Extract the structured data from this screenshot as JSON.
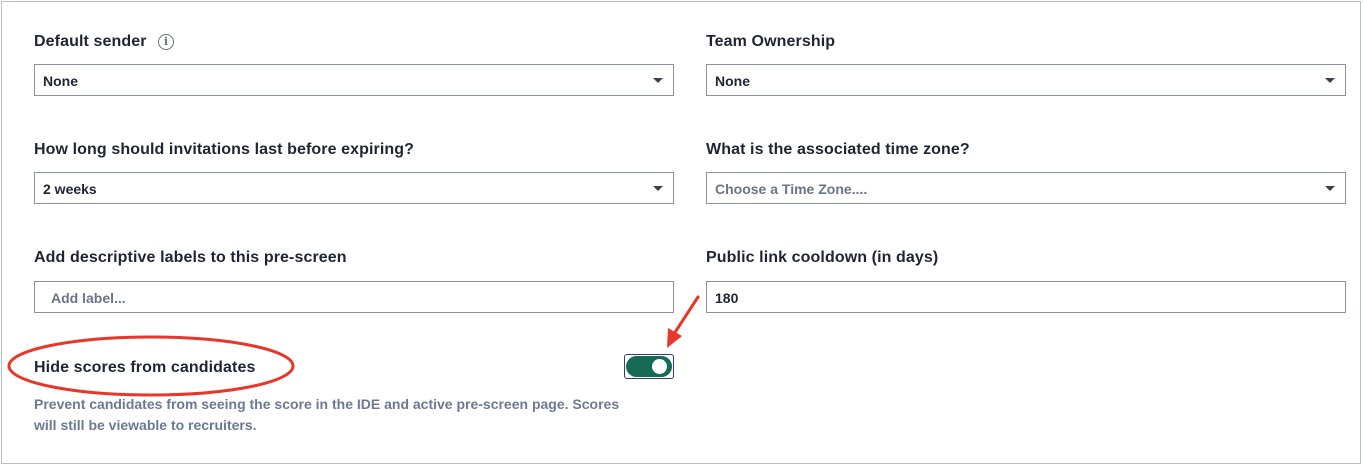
{
  "form": {
    "default_sender": {
      "label": "Default sender",
      "value": "None"
    },
    "team_ownership": {
      "label": "Team Ownership",
      "value": "None"
    },
    "invitation_expiry": {
      "label": "How long should invitations last before expiring?",
      "value": "2 weeks"
    },
    "time_zone": {
      "label": "What is the associated time zone?",
      "placeholder": "Choose a Time Zone...."
    },
    "labels": {
      "label": "Add descriptive labels to this pre-screen",
      "placeholder": "Add label..."
    },
    "public_link_cooldown": {
      "label": "Public link cooldown (in days)",
      "value": "180"
    },
    "hide_scores": {
      "label": "Hide scores from candidates",
      "enabled": true,
      "helper_line1": "Prevent candidates from seeing the score in the IDE and active pre-screen page. Scores",
      "helper_line2": "will still be viewable to recruiters."
    }
  },
  "icons": {
    "info": "info-circle-icon",
    "dropdown": "chevron-down-icon"
  },
  "colors": {
    "toggle_on": "#156b55",
    "annotation": "#e8362a"
  }
}
